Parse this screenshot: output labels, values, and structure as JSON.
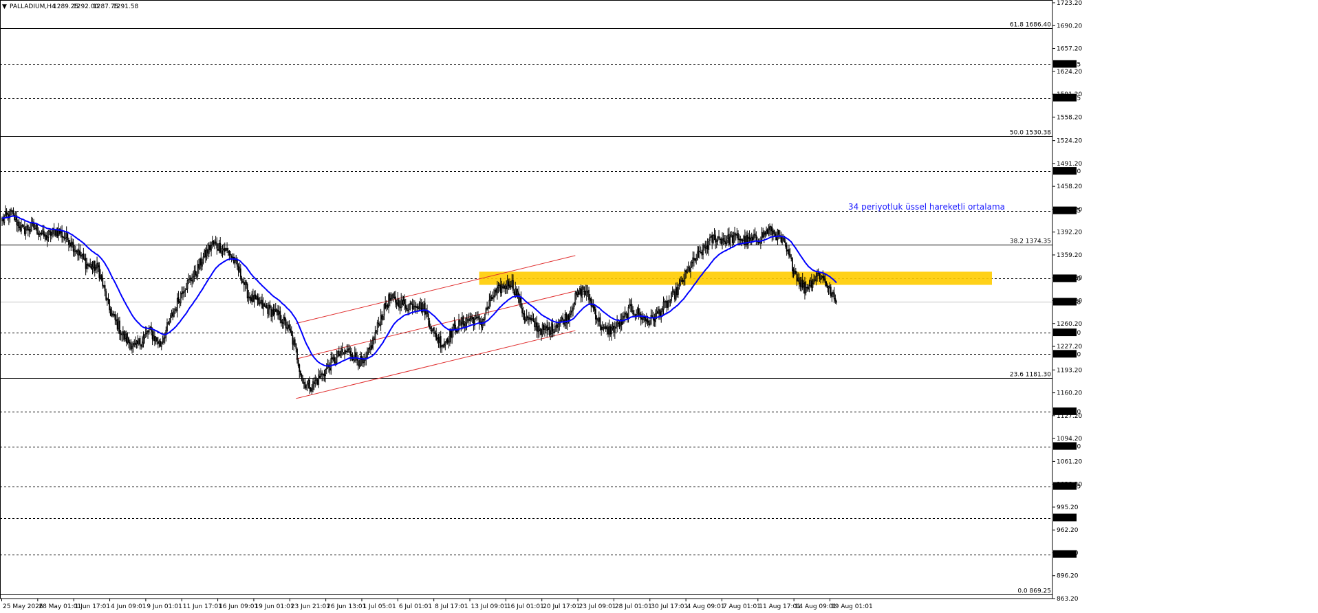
{
  "chart_data": {
    "type": "candlestick",
    "title": "PALLADIUM,H4",
    "ohlc": [
      "1289.25",
      "1292.00",
      "1287.75",
      "1291.58"
    ],
    "ylim": [
      863.2,
      1723.2
    ],
    "y_ticks": [
      "1723.20",
      "1690.20",
      "1657.20",
      "1624.20",
      "1591.20",
      "1558.20",
      "1524.20",
      "1491.20",
      "1458.20",
      "1425.20",
      "1392.20",
      "1359.20",
      "1326.20",
      "1293.20",
      "1260.20",
      "1227.20",
      "1193.20",
      "1160.20",
      "1127.20",
      "1094.20",
      "1061.20",
      "1028.20",
      "995.20",
      "962.20",
      "929.20",
      "896.20",
      "863.20"
    ],
    "x_ticks": [
      "25 May 2026",
      "28 May 01:01",
      "1 Jun 17:01",
      "4 Jun 09:01",
      "9 Jun 01:01",
      "11 Jun 17:01",
      "16 Jun 09:01",
      "19 Jun 01:01",
      "23 Jun 21:01",
      "26 Jun 13:01",
      "1 Jul 05:01",
      "6 Jul 01:01",
      "8 Jul 17:01",
      "13 Jul 09:01",
      "16 Jul 01:01",
      "20 Jul 17:01",
      "23 Jul 09:01",
      "28 Jul 01:01",
      "30 Jul 17:01",
      "4 Aug 09:01",
      "7 Aug 01:01",
      "11 Aug 17:01",
      "14 Aug 09:01",
      "19 Aug 01:01"
    ],
    "horizontal_levels": [
      {
        "value": 1634.45,
        "label": "1634.45",
        "style": "dashed"
      },
      {
        "value": 1585.75,
        "label": "1585.75",
        "style": "dashed"
      },
      {
        "value": 1480.1,
        "label": "1480.10",
        "style": "dashed"
      },
      {
        "value": 1423.05,
        "label": "1423.05",
        "style": "dashed"
      },
      {
        "value": 1325.0,
        "label": "1325.00",
        "style": "dashed"
      },
      {
        "value": 1247.0,
        "label": "1247.00",
        "style": "dashed"
      },
      {
        "value": 1216.0,
        "label": "1216.00",
        "style": "dashed"
      },
      {
        "value": 1133.1,
        "label": "1133.10",
        "style": "dashed"
      },
      {
        "value": 1082.9,
        "label": "1082.90",
        "style": "dashed"
      },
      {
        "value": 1025.25,
        "label": "1025.25",
        "style": "dashed"
      },
      {
        "value": 979.75,
        "label": "979.75",
        "style": "dashed"
      },
      {
        "value": 927.05,
        "label": "927.05",
        "style": "dashed"
      }
    ],
    "fibonacci": [
      {
        "label": "61.8 1686.40",
        "value": 1686.4
      },
      {
        "label": "50.0 1530.38",
        "value": 1530.38
      },
      {
        "label": "38.2 1374.35",
        "value": 1374.35
      },
      {
        "label": "23.6 1181.30",
        "value": 1181.3
      },
      {
        "label": "0.0 869.25",
        "value": 869.25
      }
    ],
    "current_price": {
      "value": 1291.58,
      "label": "1291.58"
    },
    "resistance_zone": {
      "from": 1316,
      "to": 1335,
      "color": "#ffcc00"
    },
    "price_anchors": [
      [
        0,
        1410
      ],
      [
        8,
        1420
      ],
      [
        18,
        1395
      ],
      [
        28,
        1400
      ],
      [
        38,
        1385
      ],
      [
        48,
        1395
      ],
      [
        60,
        1380
      ],
      [
        75,
        1345
      ],
      [
        85,
        1340
      ],
      [
        95,
        1280
      ],
      [
        108,
        1240
      ],
      [
        118,
        1225
      ],
      [
        130,
        1250
      ],
      [
        140,
        1230
      ],
      [
        150,
        1270
      ],
      [
        160,
        1310
      ],
      [
        170,
        1330
      ],
      [
        178,
        1355
      ],
      [
        186,
        1375
      ],
      [
        194,
        1370
      ],
      [
        202,
        1360
      ],
      [
        210,
        1335
      ],
      [
        218,
        1300
      ],
      [
        226,
        1290
      ],
      [
        236,
        1280
      ],
      [
        246,
        1270
      ],
      [
        254,
        1250
      ],
      [
        260,
        1220
      ],
      [
        266,
        1175
      ],
      [
        274,
        1170
      ],
      [
        282,
        1185
      ],
      [
        290,
        1200
      ],
      [
        298,
        1215
      ],
      [
        306,
        1220
      ],
      [
        314,
        1210
      ],
      [
        320,
        1200
      ],
      [
        326,
        1225
      ],
      [
        334,
        1265
      ],
      [
        342,
        1295
      ],
      [
        350,
        1292
      ],
      [
        358,
        1285
      ],
      [
        366,
        1290
      ],
      [
        374,
        1280
      ],
      [
        382,
        1245
      ],
      [
        390,
        1230
      ],
      [
        398,
        1250
      ],
      [
        406,
        1260
      ],
      [
        414,
        1268
      ],
      [
        424,
        1262
      ],
      [
        434,
        1300
      ],
      [
        442,
        1312
      ],
      [
        450,
        1320
      ],
      [
        456,
        1300
      ],
      [
        462,
        1270
      ],
      [
        468,
        1262
      ],
      [
        476,
        1252
      ],
      [
        484,
        1250
      ],
      [
        492,
        1262
      ],
      [
        500,
        1270
      ],
      [
        508,
        1300
      ],
      [
        514,
        1310
      ],
      [
        520,
        1295
      ],
      [
        526,
        1270
      ],
      [
        532,
        1250
      ],
      [
        540,
        1252
      ],
      [
        548,
        1262
      ],
      [
        556,
        1282
      ],
      [
        564,
        1272
      ],
      [
        572,
        1262
      ],
      [
        580,
        1275
      ],
      [
        590,
        1292
      ],
      [
        598,
        1310
      ],
      [
        606,
        1336
      ],
      [
        614,
        1355
      ],
      [
        622,
        1370
      ],
      [
        630,
        1385
      ],
      [
        640,
        1380
      ],
      [
        650,
        1385
      ],
      [
        660,
        1378
      ],
      [
        670,
        1384
      ],
      [
        678,
        1395
      ],
      [
        686,
        1388
      ],
      [
        692,
        1372
      ],
      [
        698,
        1348
      ],
      [
        704,
        1325
      ],
      [
        710,
        1310
      ],
      [
        716,
        1320
      ],
      [
        722,
        1332
      ],
      [
        728,
        1322
      ],
      [
        734,
        1302
      ],
      [
        738,
        1288
      ]
    ],
    "series": [
      {
        "name": "34 periyotluk üssel hareketli ortalama",
        "type": "ema",
        "period": 34,
        "color": "#0000ff"
      }
    ],
    "annotations": [
      {
        "text": "34 periyotluk üssel hareketli ortalama",
        "color": "#1a1aff"
      }
    ],
    "trend_channel": {
      "color": "#e03030",
      "lines": 3
    },
    "colors": {
      "bull": "#ffffff",
      "bear": "#000000",
      "ema": "#0000ff",
      "channel": "#e03030",
      "zone": "#ffcc00"
    }
  }
}
